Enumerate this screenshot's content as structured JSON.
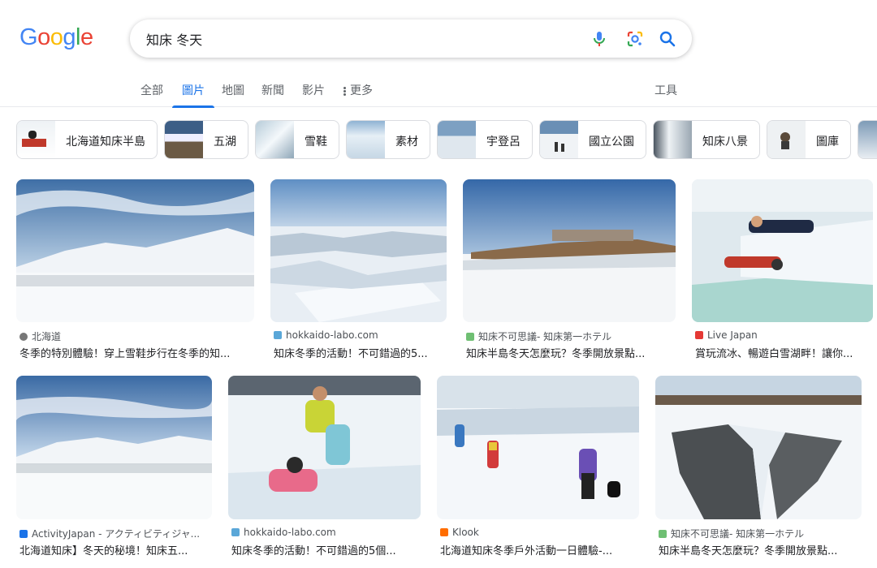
{
  "logo": {
    "letters": [
      "G",
      "o",
      "o",
      "g",
      "l",
      "e"
    ],
    "colors": [
      "#4285F4",
      "#EA4335",
      "#FBBC05",
      "#4285F4",
      "#34A853",
      "#EA4335"
    ]
  },
  "search": {
    "query": "知床 冬天"
  },
  "icons": {
    "mic": "microphone-icon",
    "lens": "google-lens-icon",
    "search": "search-icon",
    "more": "vertical-dots-icon"
  },
  "tabs": [
    "全部",
    "圖片",
    "地圖",
    "新聞",
    "影片",
    "更多"
  ],
  "active_tab": "圖片",
  "tools_label": "工具",
  "chips": [
    "北海道知床半島",
    "五湖",
    "雪鞋",
    "素材",
    "宇登呂",
    "國立公園",
    "知床八景",
    "圖庫"
  ],
  "results": [
    {
      "source": "北海道",
      "title": "冬季的特別體驗！穿上雪鞋步行在冬季的知..."
    },
    {
      "source": "hokkaido-labo.com",
      "title": "知床冬季的活動！不可錯過的5..."
    },
    {
      "source": "知床不可思議- 知床第一ホテル",
      "title": "知床半島冬天怎麼玩？冬季開放景點..."
    },
    {
      "source": "Live Japan",
      "title": "賞玩流冰、暢遊白雪湖畔！讓你..."
    },
    {
      "source": "ActivityJapan - アクティビティジャ...",
      "title": "北海道知床】冬天的秘境！知床五..."
    },
    {
      "source": "hokkaido-labo.com",
      "title": "知床冬季的活動！不可錯過的5個..."
    },
    {
      "source": "Klook",
      "title": "北海道知床冬季戶外活動一日體驗-..."
    },
    {
      "source": "知床不可思議- 知床第一ホテル",
      "title": "知床半島冬天怎麼玩？冬季開放景點..."
    }
  ],
  "colors": {
    "accent": "#1a73e8",
    "text": "#202124",
    "muted": "#5f6368"
  }
}
